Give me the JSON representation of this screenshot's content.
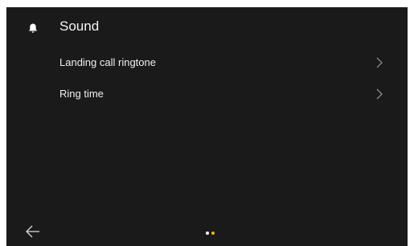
{
  "header": {
    "title": "Sound",
    "icon": "bell-icon"
  },
  "menu": {
    "items": [
      {
        "label": "Landing call ringtone",
        "icon": "chevron-right-icon"
      },
      {
        "label": "Ring time",
        "icon": "chevron-right-icon"
      }
    ]
  },
  "footer": {
    "back_icon": "arrow-left-icon",
    "pager": {
      "count": 2,
      "active_index": 1,
      "inactive_color": "#ffffff",
      "active_color": "#f5b400"
    }
  },
  "colors": {
    "background": "#1a1a1a",
    "text": "#f0f0f0"
  }
}
